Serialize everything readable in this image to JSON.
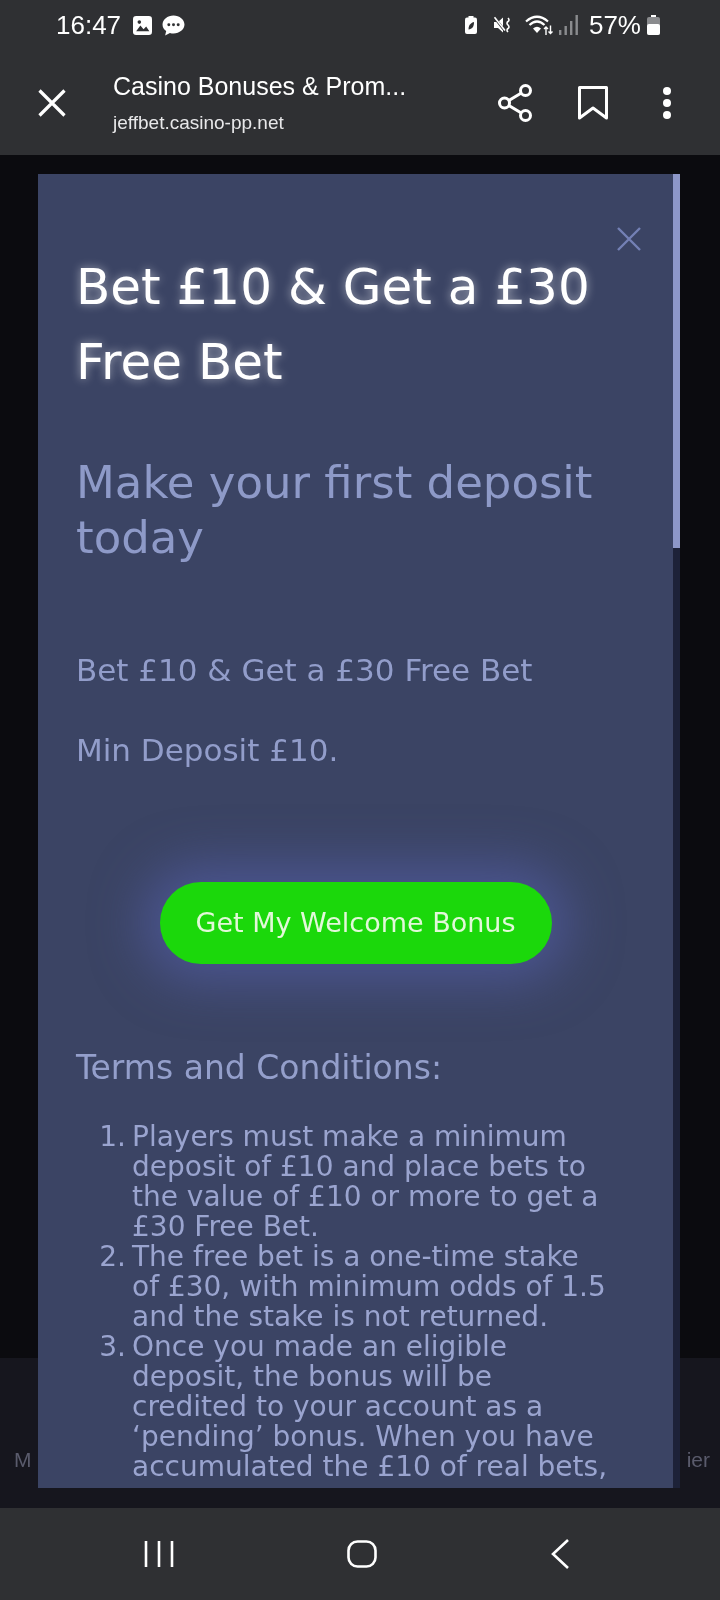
{
  "status_bar": {
    "time": "16:47",
    "battery_percent": "57%"
  },
  "browser_toolbar": {
    "title": "Casino Bonuses & Prom...",
    "url": "jeffbet.casino-pp.net"
  },
  "page_footer": {
    "left_text": "M",
    "right_text": "ier"
  },
  "modal": {
    "title": "Bet £10 & Get a £30 Free Bet",
    "subtitle": "Make your first deposit today",
    "offer": "Bet £10 & Get a £30 Free Bet",
    "min_deposit": "Min Deposit £10.",
    "cta_button": "Get My Welcome Bonus",
    "terms_heading": "Terms and Conditions:",
    "terms": [
      {
        "number": "1.",
        "text": "Players must make a minimum deposit of £10 and place bets to the value of £10 or more to get a £30 Free Bet."
      },
      {
        "number": "2.",
        "text": "The free bet is a one-time stake of £30, with minimum odds of 1.5 and the stake is not returned."
      },
      {
        "number": "3.",
        "text": "Once you made an eligible deposit, the bonus will be credited to your account as a ‘pending’ bonus. When you have accumulated the £10 of real bets,"
      }
    ]
  }
}
